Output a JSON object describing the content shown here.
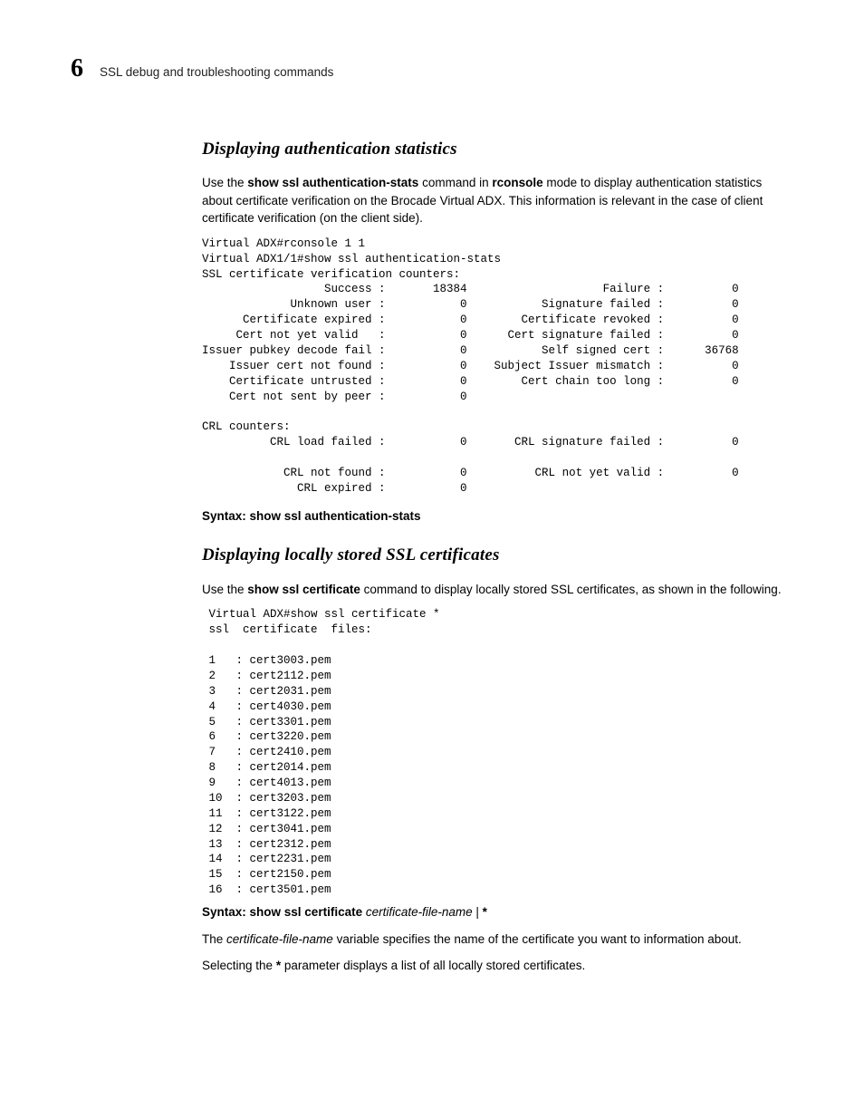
{
  "header": {
    "chapter": "6",
    "title": "SSL debug and troubleshooting commands"
  },
  "s1": {
    "heading": "Displaying authentication statistics",
    "intro_pre": "Use the ",
    "cmd1": "show ssl authentication-stats",
    "intro_mid": " command in ",
    "cmd2": "rconsole",
    "intro_post": " mode to display authentication statistics about certificate verification on the Brocade Virtual ADX. This information is relevant in the case of client certificate verification (on the client side).",
    "term": "Virtual ADX#rconsole 1 1\nVirtual ADX1/1#show ssl authentication-stats\nSSL certificate verification counters:\n                  Success :       18384                    Failure :          0\n             Unknown user :           0           Signature failed :          0\n      Certificate expired :           0        Certificate revoked :          0\n     Cert not yet valid   :           0      Cert signature failed :          0\nIssuer pubkey decode fail :           0           Self signed cert :      36768\n    Issuer cert not found :           0    Subject Issuer mismatch :          0\n    Certificate untrusted :           0        Cert chain too long :          0\n    Cert not sent by peer :           0\n\nCRL counters:\n          CRL load failed :           0       CRL signature failed :          0\n\n            CRL not found :           0          CRL not yet valid :          0\n              CRL expired :           0",
    "syntax_label": "Syntax:  ",
    "syntax_cmd": "show ssl authentication-stats"
  },
  "s2": {
    "heading": "Displaying locally stored SSL certificates",
    "intro_pre": "Use the ",
    "cmd": "show ssl certificate",
    "intro_post": " command to display locally stored SSL certificates, as shown in the following.",
    "term": " Virtual ADX#show ssl certificate *\n ssl  certificate  files:\n\n 1   : cert3003.pem\n 2   : cert2112.pem\n 3   : cert2031.pem\n 4   : cert4030.pem\n 5   : cert3301.pem\n 6   : cert3220.pem\n 7   : cert2410.pem\n 8   : cert2014.pem\n 9   : cert4013.pem\n 10  : cert3203.pem\n 11  : cert3122.pem\n 12  : cert3041.pem\n 13  : cert2312.pem\n 14  : cert2231.pem\n 15  : cert2150.pem\n 16  : cert3501.pem",
    "syntax_label": "Syntax:  ",
    "syntax_cmd": "show ssl certificate",
    "syntax_var": " certificate-file-name ",
    "syntax_pipe": "| ",
    "syntax_star": "*",
    "note_pre": "The ",
    "note_var": "certificate-file-name",
    "note_post": " variable specifies the name of the certificate you want to information about.",
    "note2_pre": "Selecting the ",
    "note2_star": "*",
    "note2_post": " parameter displays a list of all locally stored certificates."
  }
}
